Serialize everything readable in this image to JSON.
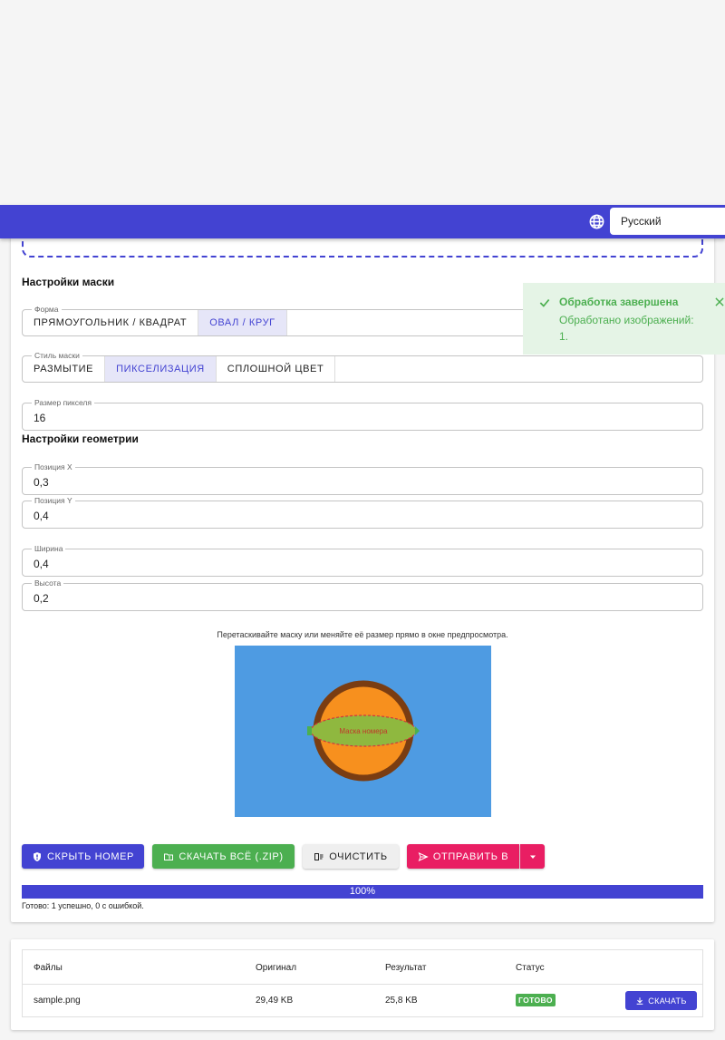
{
  "header": {
    "language": "Русский"
  },
  "mask_settings": {
    "title": "Настройки маски",
    "shape": {
      "label": "Форма",
      "options": [
        "ПРЯМОУГОЛЬНИК / КВАДРАТ",
        "ОВАЛ / КРУГ"
      ],
      "selected": "ОВАЛ / КРУГ"
    },
    "style": {
      "label": "Стиль маски",
      "options": [
        "РАЗМЫТИЕ",
        "ПИКСЕЛИЗАЦИЯ",
        "СПЛОШНОЙ ЦВЕТ"
      ],
      "selected": "ПИКСЕЛИЗАЦИЯ"
    },
    "pixel_size": {
      "label": "Размер пикселя",
      "value": "16"
    }
  },
  "geometry": {
    "title": "Настройки геометрии",
    "pos_x": {
      "label": "Позиция X",
      "value": "0,3"
    },
    "pos_y": {
      "label": "Позиция Y",
      "value": "0,4"
    },
    "width": {
      "label": "Ширина",
      "value": "0,4"
    },
    "height": {
      "label": "Высота",
      "value": "0,2"
    }
  },
  "preview": {
    "hint": "Перетаскивайте маску или меняйте её размер прямо в окне предпросмотра.",
    "mask_label": "Маска номера"
  },
  "actions": {
    "hide": "СКРЫТЬ НОМЕР",
    "download_all": "СКАЧАТЬ ВСЁ (.ZIP)",
    "clear": "ОЧИСТИТЬ",
    "send": "ОТПРАВИТЬ В"
  },
  "progress": {
    "percent": 100,
    "label": "100%",
    "status": "Готово: 1 успешно, 0 с ошибкой."
  },
  "table": {
    "headers": [
      "Файлы",
      "Оригинал",
      "Результат",
      "Статус"
    ],
    "rows": [
      {
        "file": "sample.png",
        "original": "29,49 KB",
        "result": "25,8 KB",
        "status": "ГОТОВО",
        "action": "СКАЧАТЬ"
      }
    ]
  },
  "toast": {
    "title": "Обработка завершена",
    "body": "Обработано изображений: 1."
  },
  "colors": {
    "primary": "#4343d2",
    "success": "#4caf50",
    "accent": "#e91e63",
    "preview_bg": "#4e9be2"
  }
}
